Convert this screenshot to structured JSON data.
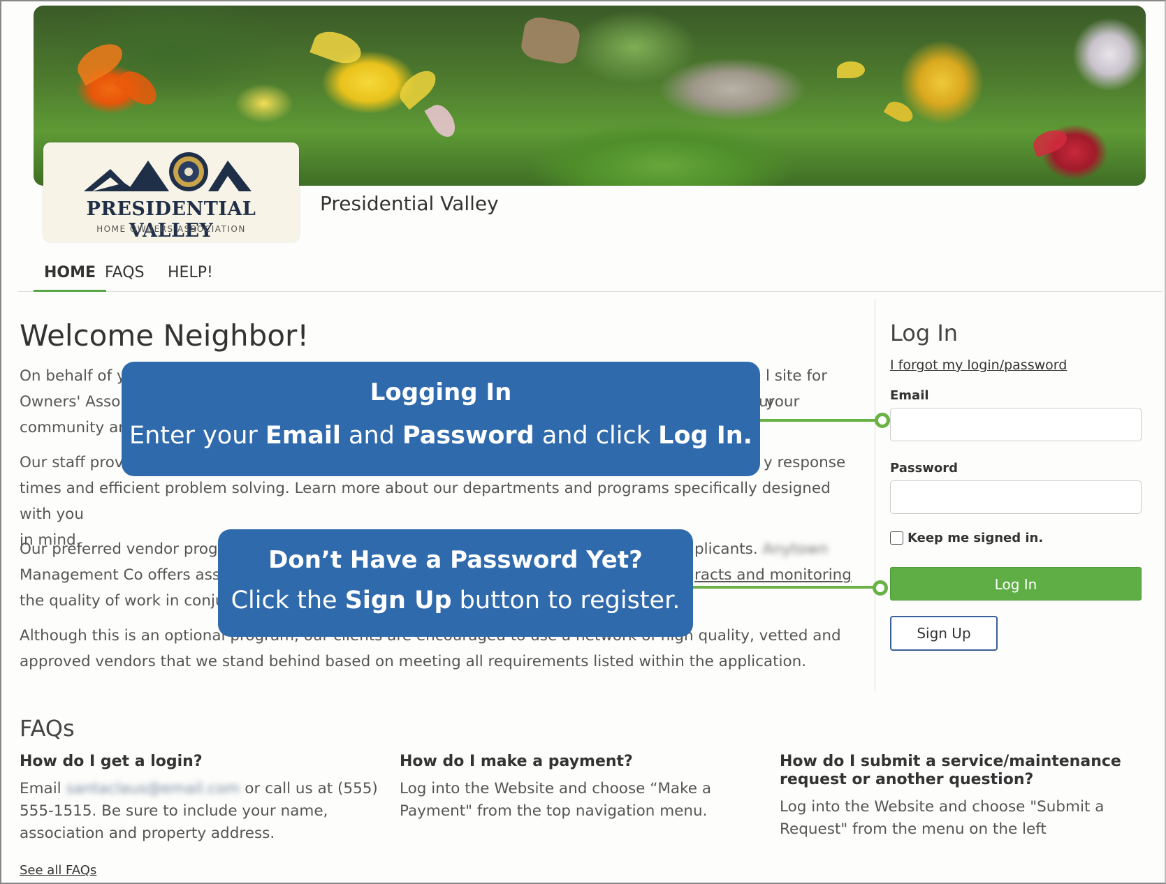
{
  "logo": {
    "name": "PRESIDENTIAL VALLEY",
    "subtitle": "HOME OWNERS ASSOCIATION"
  },
  "site_title": "Presidential Valley",
  "nav": {
    "tabs": [
      {
        "label": "HOME",
        "active": true
      },
      {
        "label": "FAQS",
        "active": false
      },
      {
        "label": "HELP!",
        "active": false
      }
    ]
  },
  "welcome": {
    "heading": "Welcome Neighbor!",
    "p1_a": "On behalf of y",
    "p1_b": "l site for your",
    "p1_c": "Owners' Asso",
    "p1_d": "ur",
    "p1_e": "community an",
    "p2_a": "Our staff provi",
    "p2_b": "y response",
    "p2_line2": "times and efficient problem solving. Learn more about our departments and programs specifically designed with you",
    "p2_line3": "in mind.",
    "p3_a": "Our preferred vendor progra",
    "p3_b": "plicants.",
    "p3_blur": "Anytown",
    "p3_c": "Management Co offers assis",
    "p3_d": "racts and monitoring",
    "p3_e": "the quality of work in conju",
    "p4_a": "Although this is an optional ",
    "p4_b": "program, our clients are encouraged to use a network of high quality, vetted and",
    "p4_line2": "approved vendors that we stand behind based on meeting all requirements listed within the application."
  },
  "login": {
    "title": "Log In",
    "forgot_link": "I forgot my login/password",
    "email_label": "Email",
    "email_value": "",
    "password_label": "Password",
    "password_value": "",
    "keep_signed_in": "Keep me signed in.",
    "login_button": "Log In",
    "signup_button": "Sign Up"
  },
  "faqs": {
    "heading": "FAQs",
    "items": [
      {
        "question": "How do I get a login?",
        "answer_a": "Email",
        "answer_blur": "santaclaus@email.com",
        "answer_b": "or call us at (555)",
        "answer_line2": "555-1515. Be sure to include your name,",
        "answer_line3": "association and property address."
      },
      {
        "question": "How do I make a payment?",
        "answer_line1": "Log into the Website and choose “Make a",
        "answer_line2": "Payment\" from the top navigation menu."
      },
      {
        "question_line1": "How do I submit a service/maintenance",
        "question_line2": "request or another question?",
        "answer_line1": "Log into the Website and choose \"Submit a",
        "answer_line2": "Request\" from the menu on the left"
      }
    ],
    "see_all": "See all FAQs"
  },
  "callouts": {
    "login": {
      "title": "Logging In",
      "t1": "Enter your ",
      "b1": "Email",
      "t2": " and ",
      "b2": "Password",
      "t3": " and click ",
      "b3": "Log In."
    },
    "signup": {
      "title": "Don’t Have a Password Yet?",
      "t1": "Click the ",
      "b1": "Sign Up",
      "t2": " button to register."
    }
  },
  "colors": {
    "accent_green": "#5fae45",
    "callout_blue": "#2f6aad",
    "signup_border": "#3a5f9a"
  }
}
